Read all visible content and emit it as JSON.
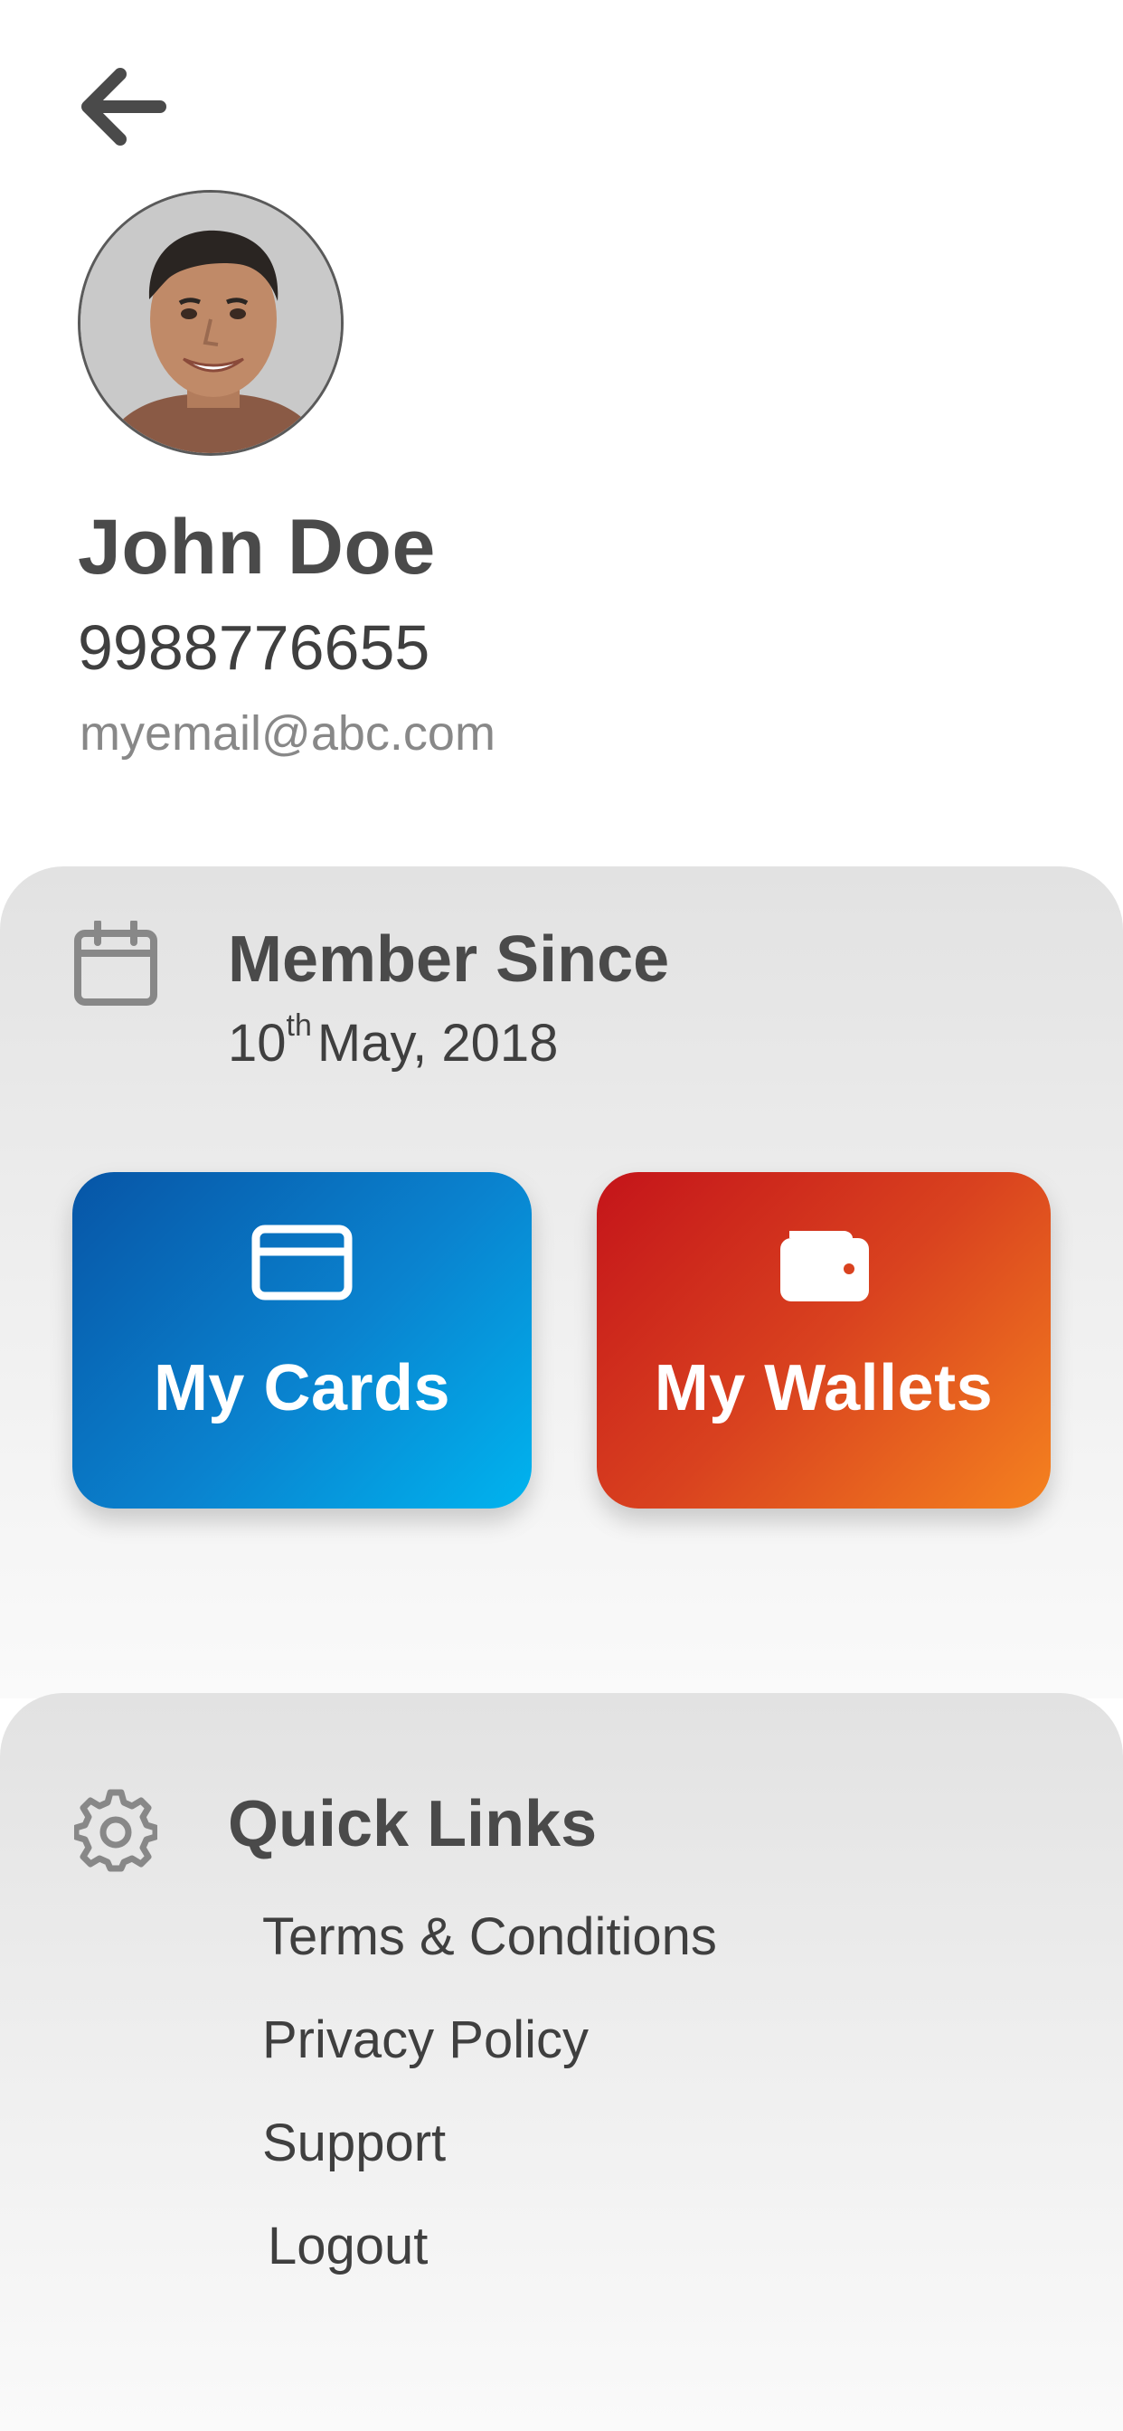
{
  "header": {
    "back_icon": "arrow-left-icon"
  },
  "profile": {
    "name": "John Doe",
    "phone": "9988776655",
    "email": "myemail@abc.com",
    "avatar_icon": "profile-photo"
  },
  "member": {
    "icon": "calendar-icon",
    "title": "Member Since",
    "date_day": "10",
    "date_suffix": "th",
    "date_rest": "May, 2018"
  },
  "tiles": {
    "cards": {
      "label": "My Cards",
      "icon": "credit-card-icon",
      "gradient": [
        "#0755a6",
        "#00b4ef"
      ]
    },
    "wallets": {
      "label": "My Wallets",
      "icon": "wallet-icon",
      "gradient": [
        "#c4141a",
        "#f5821f"
      ]
    }
  },
  "quick_links": {
    "icon": "gear-icon",
    "title": "Quick Links",
    "items": [
      {
        "label": "Terms & Conditions"
      },
      {
        "label": "Privacy Policy"
      },
      {
        "label": "Support"
      },
      {
        "label": "Logout"
      }
    ]
  },
  "colors": {
    "text": "#4a4a4a",
    "muted": "#888888",
    "panel": "#e6e6e6"
  }
}
